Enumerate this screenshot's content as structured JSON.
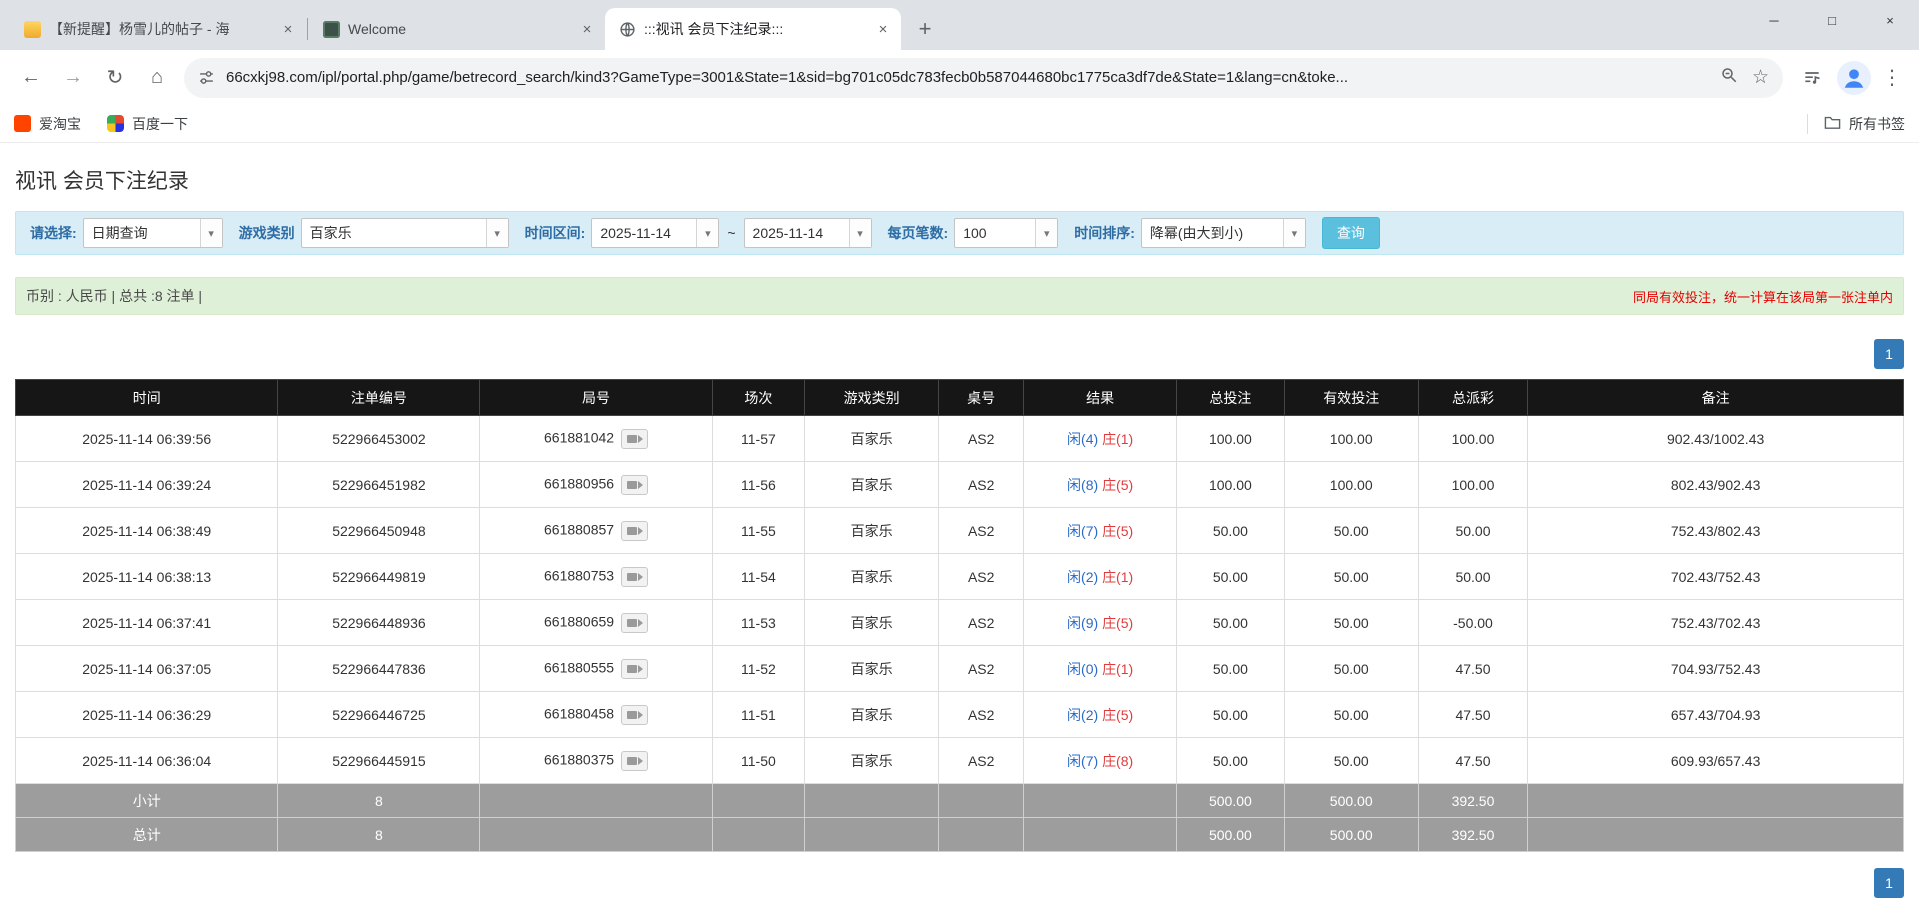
{
  "icons": {
    "back": "←",
    "forward": "→",
    "refresh": "↻",
    "home": "⌂",
    "new_tab": "+",
    "tab_close": "×",
    "minimize": "─",
    "maximize": "□",
    "window_close": "×",
    "star": "☆",
    "menu": "⋮",
    "caret": "▾"
  },
  "browser": {
    "tabs": [
      {
        "title": "【新提醒】杨雪儿的帖子 - 海"
      },
      {
        "title": "Welcome"
      },
      {
        "title": ":::视讯 会员下注纪录:::"
      }
    ],
    "url": "66cxkj98.com/ipl/portal.php/game/betrecord_search/kind3?GameType=3001&State=1&sid=bg701c05dc783fecb0b587044680bc1775ca3df7de&State=1&lang=cn&toke...",
    "bookmarks": {
      "items": [
        {
          "label": "爱淘宝"
        },
        {
          "label": "百度一下"
        }
      ],
      "all_bookmarks": "所有书签"
    }
  },
  "page": {
    "title": "视讯 会员下注纪录",
    "filters": {
      "select_label": "请选择:",
      "select_value": "日期查询",
      "game_type_label": "游戏类别",
      "game_type_value": "百家乐",
      "date_range_label": "时间区间:",
      "date_from": "2025-11-14",
      "range_separator": "~",
      "date_to": "2025-11-14",
      "page_size_label": "每页笔数:",
      "page_size_value": "100",
      "sort_label": "时间排序:",
      "sort_value": "降幂(由大到小)",
      "search_button": "查询"
    },
    "info_bar": {
      "left": "币别 : 人民币 | 总共 :8 注单 |",
      "right": "同局有效投注，统一计算在该局第一张注单内"
    },
    "pagination": {
      "current_page": "1"
    },
    "table": {
      "headers": [
        "时间",
        "注单编号",
        "局号",
        "场次",
        "游戏类别",
        "桌号",
        "结果",
        "总投注",
        "有效投注",
        "总派彩",
        "备注"
      ],
      "rows": [
        {
          "time": "2025-11-14 06:39:56",
          "bet_id": "522966453002",
          "round_id": "661881042",
          "session": "11-57",
          "game": "百家乐",
          "table_no": "AS2",
          "result_player": "闲(4)",
          "result_banker": "庄(1)",
          "total_bet": "100.00",
          "valid_bet": "100.00",
          "payout": "100.00",
          "note": "902.43/1002.43"
        },
        {
          "time": "2025-11-14 06:39:24",
          "bet_id": "522966451982",
          "round_id": "661880956",
          "session": "11-56",
          "game": "百家乐",
          "table_no": "AS2",
          "result_player": "闲(8)",
          "result_banker": "庄(5)",
          "total_bet": "100.00",
          "valid_bet": "100.00",
          "payout": "100.00",
          "note": "802.43/902.43"
        },
        {
          "time": "2025-11-14 06:38:49",
          "bet_id": "522966450948",
          "round_id": "661880857",
          "session": "11-55",
          "game": "百家乐",
          "table_no": "AS2",
          "result_player": "闲(7)",
          "result_banker": "庄(5)",
          "total_bet": "50.00",
          "valid_bet": "50.00",
          "payout": "50.00",
          "note": "752.43/802.43"
        },
        {
          "time": "2025-11-14 06:38:13",
          "bet_id": "522966449819",
          "round_id": "661880753",
          "session": "11-54",
          "game": "百家乐",
          "table_no": "AS2",
          "result_player": "闲(2)",
          "result_banker": "庄(1)",
          "total_bet": "50.00",
          "valid_bet": "50.00",
          "payout": "50.00",
          "note": "702.43/752.43"
        },
        {
          "time": "2025-11-14 06:37:41",
          "bet_id": "522966448936",
          "round_id": "661880659",
          "session": "11-53",
          "game": "百家乐",
          "table_no": "AS2",
          "result_player": "闲(9)",
          "result_banker": "庄(5)",
          "total_bet": "50.00",
          "valid_bet": "50.00",
          "payout": "-50.00",
          "note": "752.43/702.43"
        },
        {
          "time": "2025-11-14 06:37:05",
          "bet_id": "522966447836",
          "round_id": "661880555",
          "session": "11-52",
          "game": "百家乐",
          "table_no": "AS2",
          "result_player": "闲(0)",
          "result_banker": "庄(1)",
          "total_bet": "50.00",
          "valid_bet": "50.00",
          "payout": "47.50",
          "note": "704.93/752.43"
        },
        {
          "time": "2025-11-14 06:36:29",
          "bet_id": "522966446725",
          "round_id": "661880458",
          "session": "11-51",
          "game": "百家乐",
          "table_no": "AS2",
          "result_player": "闲(2)",
          "result_banker": "庄(5)",
          "total_bet": "50.00",
          "valid_bet": "50.00",
          "payout": "47.50",
          "note": "657.43/704.93"
        },
        {
          "time": "2025-11-14 06:36:04",
          "bet_id": "522966445915",
          "round_id": "661880375",
          "session": "11-50",
          "game": "百家乐",
          "table_no": "AS2",
          "result_player": "闲(7)",
          "result_banker": "庄(8)",
          "total_bet": "50.00",
          "valid_bet": "50.00",
          "payout": "47.50",
          "note": "609.93/657.43"
        }
      ],
      "subtotal": {
        "label": "小计",
        "count": "8",
        "total_bet": "500.00",
        "valid_bet": "500.00",
        "payout": "392.50"
      },
      "total": {
        "label": "总计",
        "count": "8",
        "total_bet": "500.00",
        "valid_bet": "500.00",
        "payout": "392.50"
      }
    }
  },
  "colors": {
    "accent_blue": "#337ab7",
    "search_button": "#5bc0de",
    "filter_bar_bg": "#d9edf7",
    "info_bar_bg": "#dff0d8",
    "table_header_bg": "#161616",
    "summary_row_bg": "#9d9d9d",
    "player_blue": "#2a6bc8",
    "banker_red": "#e03c3c",
    "negative_red": "#e60000"
  }
}
